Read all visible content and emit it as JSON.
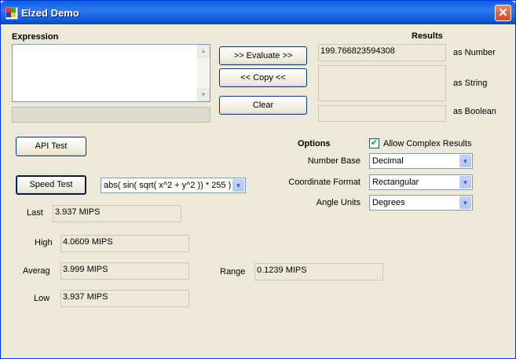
{
  "window": {
    "title": "Elzed Demo",
    "close_glyph": "✕"
  },
  "expression": {
    "label": "Expression",
    "value": "",
    "status": "",
    "scroll_up": "▲",
    "scroll_down": "▼"
  },
  "actions": {
    "evaluate_label": ">>  Evaluate  >>",
    "copy_label": "<<    Copy    <<",
    "clear_label": "Clear"
  },
  "results": {
    "label": "Results",
    "number_value": "199.766823594308",
    "number_label": "as Number",
    "string_value": "",
    "string_label": "as String",
    "boolean_value": "",
    "boolean_label": "as Boolean"
  },
  "api_test": {
    "label": "API Test"
  },
  "speed_test": {
    "label": "Speed Test",
    "expression_selected": "abs( sin( sqrt( x^2 + y^2 )) * 255 )",
    "dropdown_glyph": "▼"
  },
  "options": {
    "label": "Options",
    "allow_complex_label": "Allow Complex Results",
    "allow_complex_checked": true,
    "check_glyph": "✔",
    "number_base_label": "Number Base",
    "number_base_value": "Decimal",
    "coordinate_format_label": "Coordinate Format",
    "coordinate_format_value": "Rectangular",
    "angle_units_label": "Angle Units",
    "angle_units_value": "Degrees"
  },
  "stats": {
    "last_label": "Last",
    "last_value": "3.937 MIPS",
    "high_label": "High",
    "high_value": "4.0609 MIPS",
    "average_label": "Averag",
    "average_value": "3.999 MIPS",
    "low_label": "Low",
    "low_value": "3.937 MIPS",
    "range_label": "Range",
    "range_value": "0.1239 MIPS"
  }
}
